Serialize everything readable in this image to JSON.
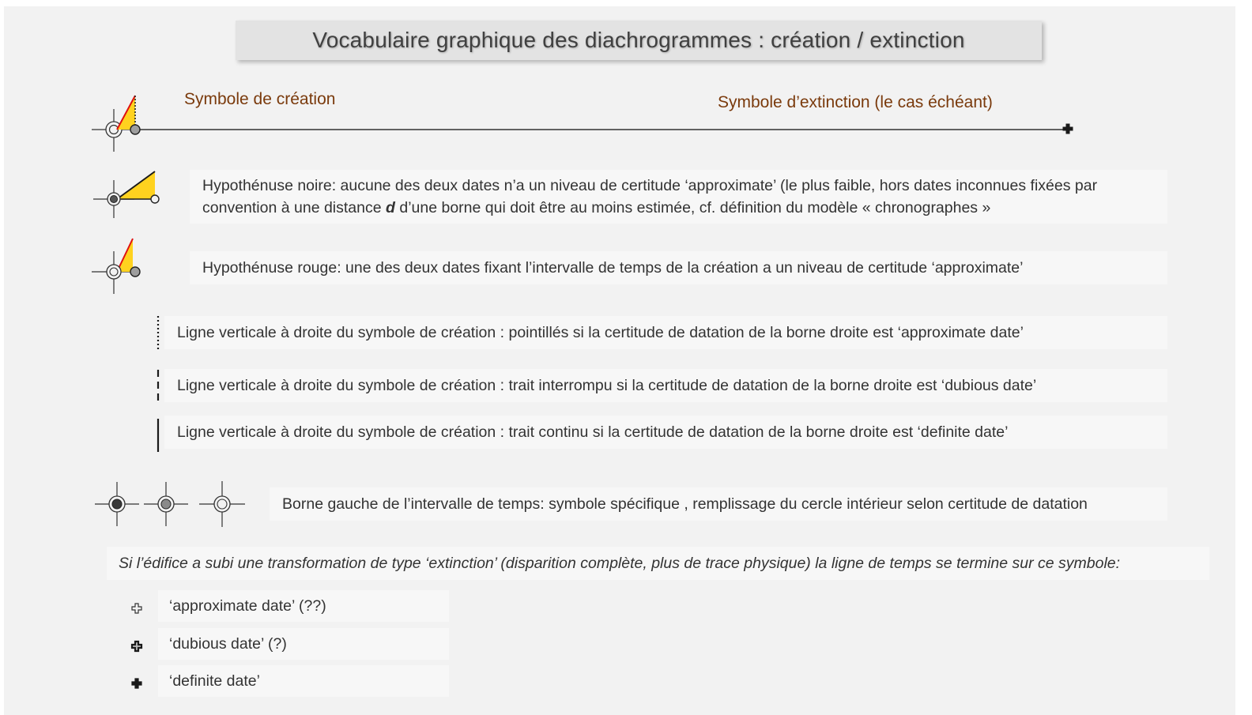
{
  "title": "Vocabulaire graphique des diachrogrammes : création / extinction",
  "timeline": {
    "creation_label": "Symbole de création",
    "extinction_label": "Symbole d’extinction (le cas échéant)"
  },
  "hypotenuse_black": {
    "line1": "Hypothénuse noire: aucune des deux dates n’a un niveau de certitude ‘approximate’ (le plus faible, hors dates inconnues fixées par",
    "line2_before": "convention à une distance ",
    "line2_var": "d",
    "line2_after": " d’une borne qui doit être au moins estimée, cf. définition du modèle « chronographes »"
  },
  "hypotenuse_red": "Hypothénuse rouge: une des deux dates fixant l’intervalle de temps de la création a un niveau de certitude ‘approximate’",
  "vertical_lines": [
    "Ligne verticale à droite du symbole de création  : pointillés si la certitude de datation de la borne droite est ‘approximate date’",
    "Ligne verticale à droite du symbole de création  : trait interrompu si la certitude de datation de la borne droite est ‘dubious date’",
    "Ligne verticale à droite du symbole de création  : trait continu si la certitude de datation de la borne droite est ‘definite date’"
  ],
  "left_bound": "Borne gauche de l’intervalle de temps: symbole spécifique , remplissage du cercle intérieur selon certitude de datation",
  "extinction_intro": "Si l’édifice a subi une transformation de type ‘extinction’ (disparition complète, plus de trace physique) la ligne de temps se termine sur ce symbole:",
  "extinction_items": [
    "‘approximate date’ (??)",
    "‘dubious date’ (?)",
    "‘definite date’"
  ],
  "colors": {
    "triangle_fill": "#ffd21f",
    "hyp_red": "#e01010",
    "hyp_black": "#1a1a1a",
    "label_orange": "#7a3a0c",
    "background": "#f2f2f2"
  }
}
